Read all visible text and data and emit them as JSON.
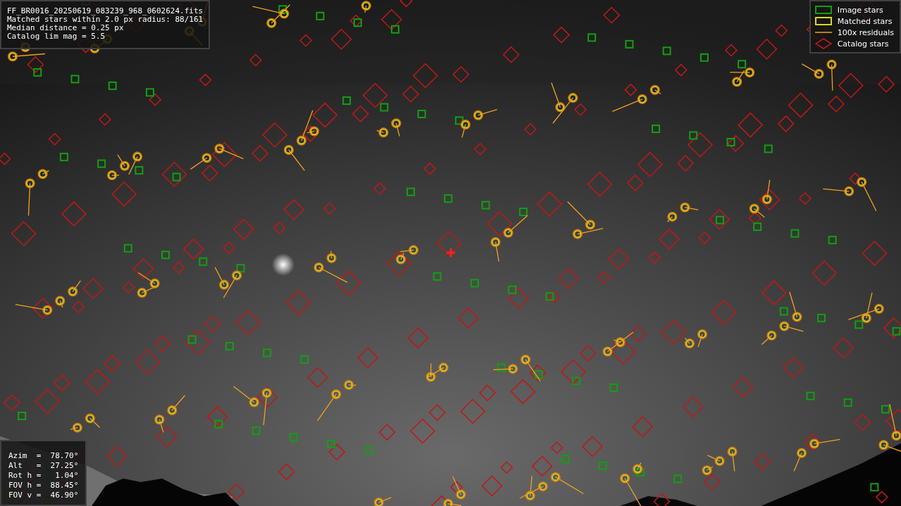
{
  "file_info": {
    "lines": [
      "FF_BR0016_20250619_083239_968_0602624.fits",
      "Matched stars within 2.0 px radius: 88/161",
      "Median distance = 0.25 px",
      "Catalog lim mag = 5.5"
    ]
  },
  "legend": {
    "items": [
      {
        "label": "Image stars"
      },
      {
        "kind": "matched",
        "label": "Matched stars"
      },
      {
        "kind": "residual",
        "label": "100x residuals"
      },
      {
        "kind": "catalog",
        "label": "Catalog stars"
      }
    ]
  },
  "pointing": {
    "lines": [
      "Azim  =  78.70°",
      "Alt   =  27.25°",
      "Rot h =   1.04°",
      "FOV h =  88.45°",
      "FOV v =  46.90°"
    ]
  }
}
